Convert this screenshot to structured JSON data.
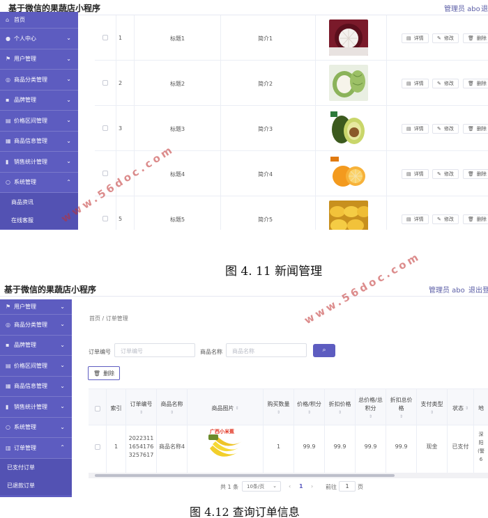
{
  "screenshot1": {
    "app_title": "基于微信的果蔬店小程序",
    "admin_label": "管理员 abo",
    "logout_label": "退",
    "menu": [
      {
        "label": "首页",
        "icon": "home-icon"
      },
      {
        "label": "个人中心",
        "icon": "user-icon"
      },
      {
        "label": "用户管理",
        "icon": "flag-icon"
      },
      {
        "label": "商品分类管理",
        "icon": "circle-icon"
      },
      {
        "label": "品牌管理",
        "icon": "box-icon"
      },
      {
        "label": "价格区间管理",
        "icon": "price-icon"
      },
      {
        "label": "商品信息管理",
        "icon": "list-icon"
      },
      {
        "label": "销售统计管理",
        "icon": "chart-icon"
      },
      {
        "label": "系统管理",
        "icon": "gear-icon"
      }
    ],
    "submenu": [
      "商品资讯",
      "在线客服"
    ],
    "rows": [
      {
        "index": "1",
        "title": "标题1",
        "intro": "简介1",
        "fruit": "mangosteen"
      },
      {
        "index": "2",
        "title": "标题2",
        "intro": "简介2",
        "fruit": "custard-apple"
      },
      {
        "index": "3",
        "title": "标题3",
        "intro": "简介3",
        "fruit": "avocado"
      },
      {
        "index": "",
        "title": "标题4",
        "intro": "简介4",
        "fruit": "orange"
      },
      {
        "index": "5",
        "title": "标题5",
        "intro": "简介5",
        "fruit": "mango"
      }
    ],
    "actions": {
      "detail": "详情",
      "edit": "修改",
      "delete": "删除"
    }
  },
  "caption1": "图 4. 11 新闻管理",
  "screenshot2": {
    "app_title": "基于微信的果蔬店小程序",
    "admin_label": "管理员 abo",
    "logout_label": "退出登",
    "menu": [
      {
        "label": "用户管理",
        "icon": "flag-icon"
      },
      {
        "label": "商品分类管理",
        "icon": "circle-icon"
      },
      {
        "label": "品牌管理",
        "icon": "box-icon"
      },
      {
        "label": "价格区间管理",
        "icon": "price-icon"
      },
      {
        "label": "商品信息管理",
        "icon": "list-icon"
      },
      {
        "label": "销售统计管理",
        "icon": "chart-icon"
      },
      {
        "label": "系统管理",
        "icon": "gear-icon"
      },
      {
        "label": "订单管理",
        "icon": "order-icon"
      }
    ],
    "submenu": [
      "已支付订单",
      "已退款订单"
    ],
    "breadcrumb": "首页 / 订单管理",
    "search": {
      "order_no_label": "订单编号",
      "order_no_placeholder": "订单编号",
      "product_name_label": "商品名称",
      "product_name_placeholder": "商品名称"
    },
    "delete_button": "删除",
    "table": {
      "headers": [
        "",
        "索引",
        "订单编号",
        "商品名称",
        "商品图片",
        "购买数量",
        "价格/积分",
        "折扣价格",
        "总价格/总积分",
        "折扣总价格",
        "支付类型",
        "状态",
        "地"
      ],
      "row": {
        "index": "1",
        "order_no": "20223111654176325761​7",
        "order_no_lines": [
          "2022311",
          "1654176",
          "3257617"
        ],
        "product_name": "商品名称4",
        "image_text": "广西小米蕉",
        "quantity": "1",
        "price": "99.9",
        "discount_price": "99.9",
        "total": "99.9",
        "discount_total": "99.9",
        "pay_type": "现金",
        "status": "已支付",
        "address_fragment": [
          "深",
          "阳",
          "(警",
          "6"
        ]
      }
    },
    "pagination": {
      "total": "共 1 条",
      "page_size": "10条/页",
      "current_page": "1",
      "goto_label": "前往",
      "goto_value": "1",
      "page_unit": "页"
    }
  },
  "caption2": "图 4.12  查询订单信息",
  "watermark": "www.56doc.com",
  "colors": {
    "sidebar": "#5d5cc0",
    "accent": "#5b5ea6",
    "watermark": "#c03030"
  }
}
